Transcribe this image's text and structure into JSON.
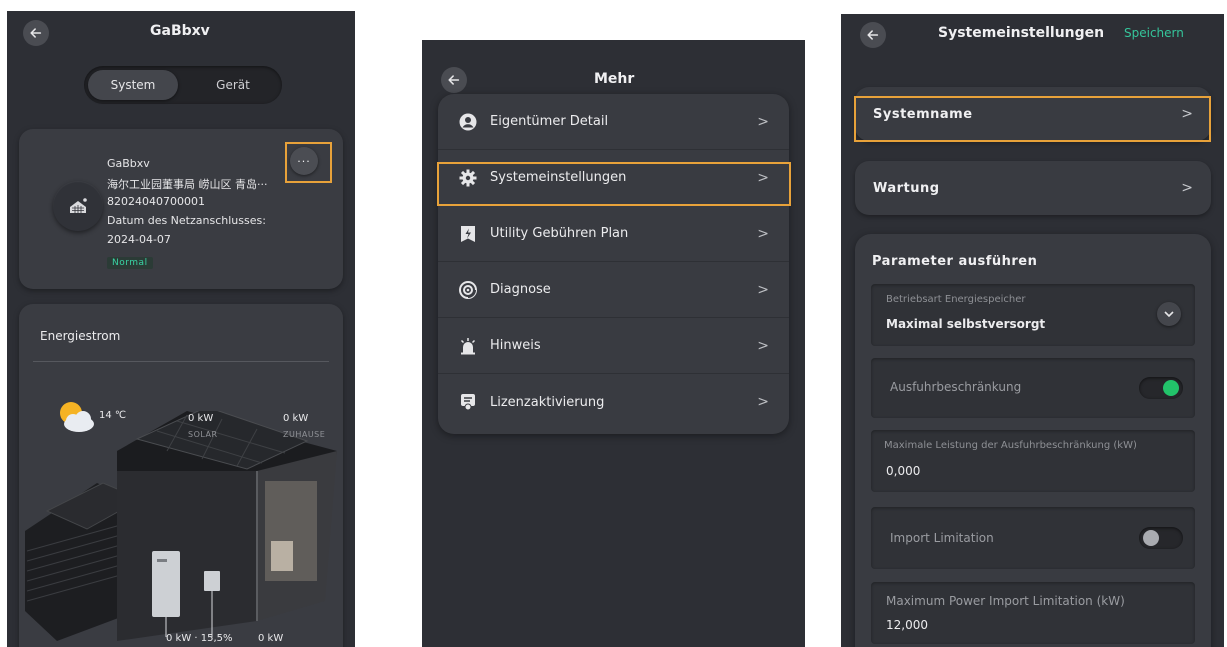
{
  "screen1": {
    "title": "GaBbxv",
    "tabs": [
      {
        "label": "System",
        "active": true
      },
      {
        "label": "Gerät",
        "active": false
      }
    ],
    "info": {
      "name": "GaBbxv",
      "address": "海尔工业园董事局 崂山区 青岛···",
      "id": "82024040700001",
      "grid_date_label": "Datum des Netzanschlusses:",
      "grid_date": "2024-04-07",
      "status": "Normal"
    },
    "more_label": "···",
    "energy": {
      "title": "Energiestrom",
      "temperature": "14 ℃",
      "solar_value": "0 kW",
      "solar_label": "SOLAR",
      "home_value": "0 kW",
      "home_label": "ZUHAUSE",
      "battery_value": "0 kW · 15,5%",
      "grid_value": "0 kW"
    }
  },
  "screen2": {
    "title": "Mehr",
    "menu": [
      {
        "label": "Eigentümer Detail",
        "icon": "user-icon"
      },
      {
        "label": "Systemeinstellungen",
        "icon": "gear-icon"
      },
      {
        "label": "Utility Gebühren Plan",
        "icon": "tariff-icon"
      },
      {
        "label": "Diagnose",
        "icon": "diagnose-icon"
      },
      {
        "label": "Hinweis",
        "icon": "alarm-icon"
      },
      {
        "label": "Lizenzaktivierung",
        "icon": "license-icon"
      }
    ]
  },
  "screen3": {
    "title": "Systemeinstellungen",
    "save_label": "Speichern",
    "rows": [
      {
        "label": "Systemname"
      },
      {
        "label": "Wartung"
      }
    ],
    "params": {
      "title": "Parameter ausführen",
      "mode_label": "Betriebsart Energiespeicher",
      "mode_value": "Maximal selbstversorgt",
      "export_limit_label": "Ausfuhrbeschränkung",
      "export_limit_on": true,
      "export_max_label": "Maximale Leistung der Ausfuhrbeschränkung (kW)",
      "export_max_value": "0,000",
      "import_limit_label": "Import Limitation",
      "import_limit_on": false,
      "import_max_label": "Maximum Power Import Limitation (kW)",
      "import_max_value": "12,000"
    }
  },
  "colors": {
    "highlight": "#e8a23a",
    "accent_green": "#35c59b",
    "toggle_on": "#22c36a",
    "background": "#2d2f35"
  }
}
